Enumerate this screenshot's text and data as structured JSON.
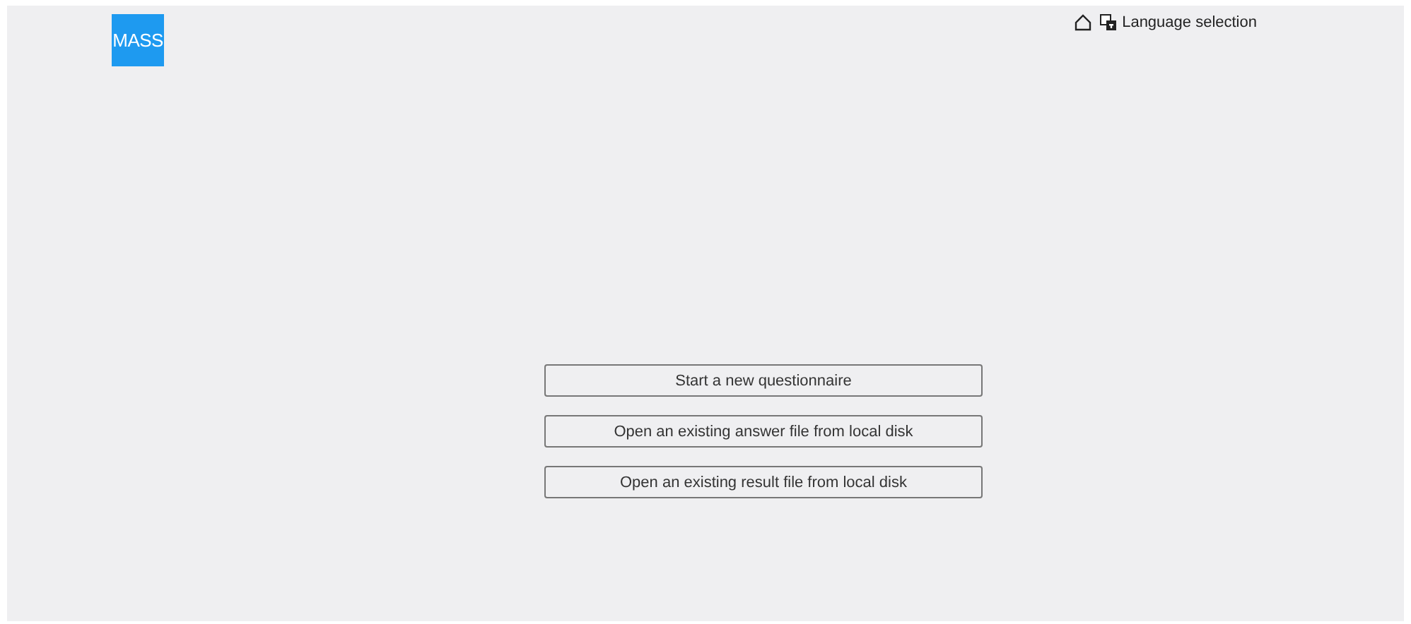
{
  "logo": {
    "text": "MASS"
  },
  "header": {
    "language_link": "Language selection"
  },
  "actions": [
    "Start a new questionnaire",
    "Open an existing answer file from local disk",
    "Open an existing result file from local disk"
  ]
}
